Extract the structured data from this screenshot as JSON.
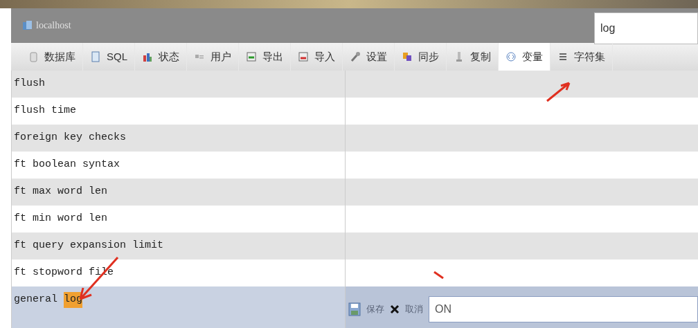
{
  "header": {
    "title": "localhost"
  },
  "search": {
    "value": "log"
  },
  "tabs": [
    {
      "label": "数据库",
      "selected": false
    },
    {
      "label": "SQL",
      "selected": false
    },
    {
      "label": "状态",
      "selected": false
    },
    {
      "label": "用户",
      "selected": false
    },
    {
      "label": "导出",
      "selected": false
    },
    {
      "label": "导入",
      "selected": false
    },
    {
      "label": "设置",
      "selected": false
    },
    {
      "label": "同步",
      "selected": false
    },
    {
      "label": "复制",
      "selected": false
    },
    {
      "label": "变量",
      "selected": true
    },
    {
      "label": "字符集",
      "selected": false
    }
  ],
  "rows": [
    {
      "name": "flush",
      "editing": false
    },
    {
      "name": "flush time",
      "editing": false
    },
    {
      "name": "foreign key checks",
      "editing": false
    },
    {
      "name": "ft boolean syntax",
      "editing": false
    },
    {
      "name": "ft max word len",
      "editing": false
    },
    {
      "name": "ft min word len",
      "editing": false
    },
    {
      "name": "ft query expansion limit",
      "editing": false
    },
    {
      "name": "ft stopword file",
      "editing": false
    },
    {
      "name": "general",
      "highlight": "log",
      "editing": true,
      "save": "保存",
      "cancel": "取消",
      "value": "ON"
    }
  ]
}
